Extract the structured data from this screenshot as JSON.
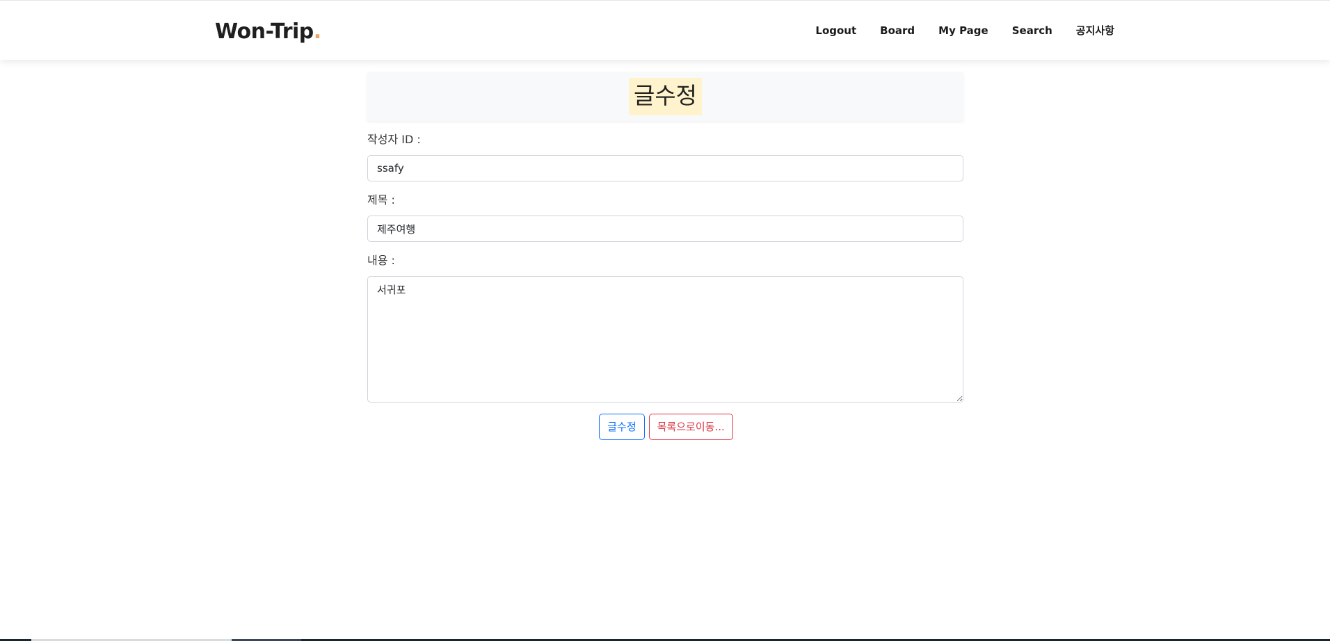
{
  "navbar": {
    "brand": "Won-Trip",
    "brand_dot": ".",
    "links": [
      "Logout",
      "Board",
      "My Page",
      "Search",
      "공지사항"
    ]
  },
  "form": {
    "title": "글수정",
    "writer_label": "작성자 ID :",
    "writer_value": "ssafy",
    "subject_label": "제목 :",
    "subject_value": "제주여행",
    "content_label": "내용 :",
    "content_value": "서귀포"
  },
  "buttons": {
    "modify_label": "글수정",
    "list_label": "목록으로이동..."
  },
  "colors": {
    "brand_dot": "#f4a261",
    "title_highlight": "#fff3cd",
    "primary": "#0d6efd",
    "danger": "#dc3545"
  }
}
